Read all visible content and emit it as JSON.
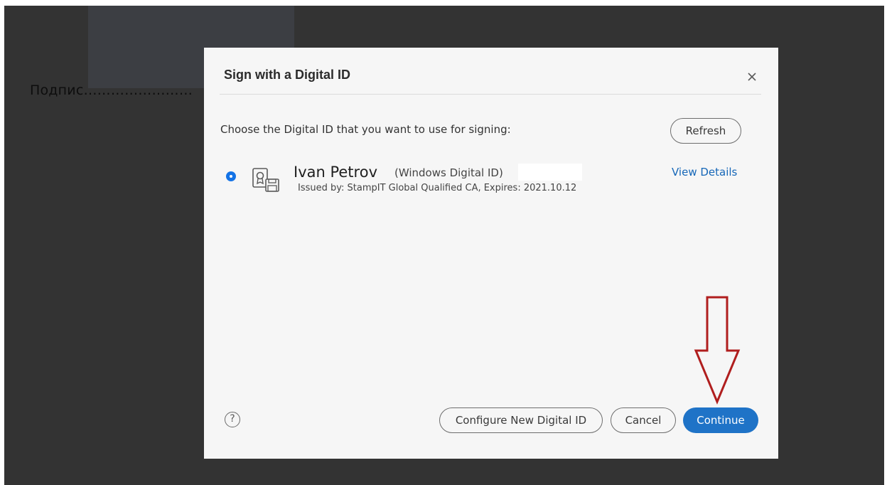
{
  "document": {
    "signature_label": "Подпис……………………"
  },
  "dialog": {
    "title": "Sign with a Digital ID",
    "close_icon": "close-icon",
    "prompt": "Choose the Digital ID that you want to use for signing:",
    "refresh_label": "Refresh",
    "digital_id": {
      "selected": true,
      "icon": "certificate-icon",
      "name": "Ivan Petrov",
      "type": "(Windows Digital ID)",
      "issuer_line": "Issued by: StampIT Global Qualified CA, Expires: 2021.10.12",
      "view_details_label": "View Details"
    },
    "footer": {
      "help_glyph": "?",
      "configure_label": "Configure New Digital ID",
      "cancel_label": "Cancel",
      "continue_label": "Continue"
    }
  },
  "annotation": {
    "arrow_icon": "down-arrow-annotation",
    "arrow_color": "#b01e1e"
  },
  "colors": {
    "backdrop": "#333333",
    "dialog_bg": "#f6f6f6",
    "accent": "#1f73c7",
    "link": "#1667b8"
  }
}
